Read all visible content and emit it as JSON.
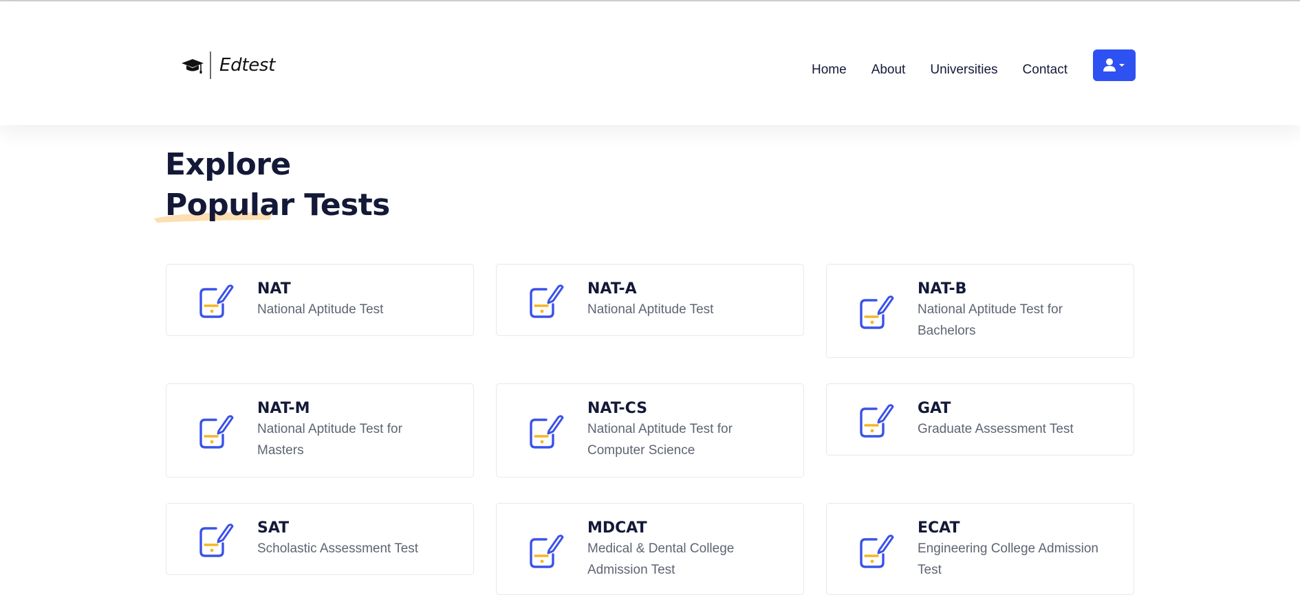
{
  "header": {
    "brand": "Edtest",
    "logo_icon": "graduation-cap-icon",
    "nav": [
      "Home",
      "About",
      "Universities",
      "Contact"
    ],
    "user_button_icon": "user-icon",
    "accent_color": "#2e51f2"
  },
  "section": {
    "title_line1": "Explore",
    "title_line2": "Popular Tests"
  },
  "tests": [
    {
      "name": "NAT",
      "description": "National Aptitude Test"
    },
    {
      "name": "NAT-A",
      "description": "National Aptitude Test"
    },
    {
      "name": "NAT-B",
      "description": "National Aptitude Test for Bachelors"
    },
    {
      "name": "NAT-M",
      "description": "National Aptitude Test for Masters"
    },
    {
      "name": "NAT-CS",
      "description": "National Aptitude Test for Computer Science"
    },
    {
      "name": "GAT",
      "description": "Graduate Assessment Test"
    },
    {
      "name": "SAT",
      "description": "Scholastic Assessment Test"
    },
    {
      "name": "MDCAT",
      "description": "Medical & Dental College Admission Test"
    },
    {
      "name": "ECAT",
      "description": "Engineering College Admission Test"
    }
  ],
  "test_icon": "exam-pen-icon"
}
